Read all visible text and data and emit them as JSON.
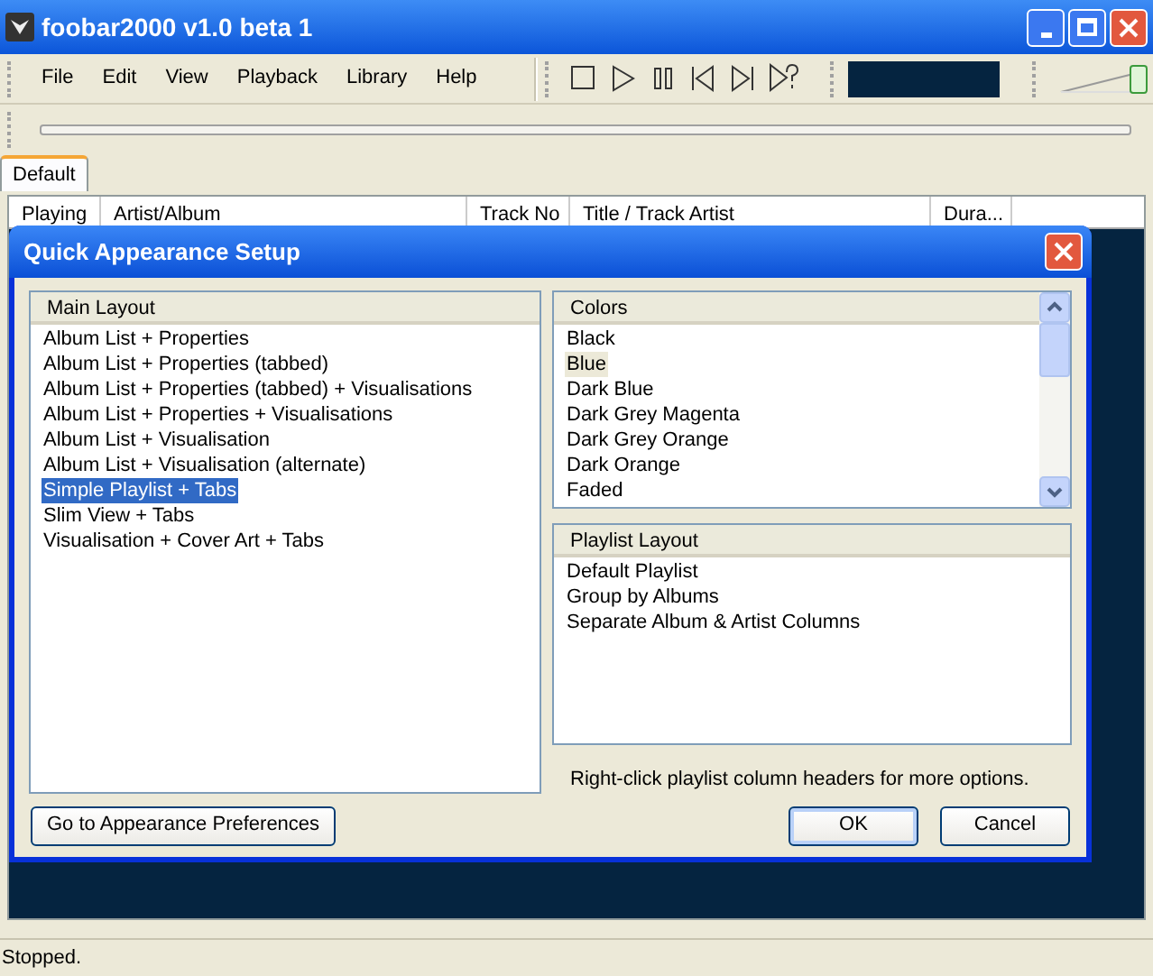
{
  "window": {
    "title": "foobar2000 v1.0 beta 1"
  },
  "menu": [
    "File",
    "Edit",
    "View",
    "Playback",
    "Library",
    "Help"
  ],
  "volume": {
    "level": 1
  },
  "tabs": [
    {
      "label": "Default",
      "selected": true
    }
  ],
  "playlist": {
    "columns": [
      "Playing",
      "Artist/Album",
      "Track No",
      "Title / Track Artist",
      "Dura..."
    ]
  },
  "dialog": {
    "title": "Quick Appearance Setup",
    "main_layout": {
      "header": "Main Layout",
      "items": [
        {
          "label": "Album List + Properties",
          "selected": false
        },
        {
          "label": "Album List + Properties (tabbed)",
          "selected": false
        },
        {
          "label": "Album List + Properties (tabbed) + Visualisations",
          "selected": false
        },
        {
          "label": "Album List + Properties + Visualisations",
          "selected": false
        },
        {
          "label": "Album List + Visualisation",
          "selected": false
        },
        {
          "label": "Album List + Visualisation (alternate)",
          "selected": false
        },
        {
          "label": "Simple Playlist + Tabs",
          "selected": true
        },
        {
          "label": "Slim View + Tabs",
          "selected": false
        },
        {
          "label": "Visualisation + Cover Art + Tabs",
          "selected": false
        }
      ]
    },
    "colors": {
      "header": "Colors",
      "items": [
        {
          "label": "Black",
          "selected": false
        },
        {
          "label": "Blue",
          "selected": true
        },
        {
          "label": "Dark Blue",
          "selected": false
        },
        {
          "label": "Dark Grey Magenta",
          "selected": false
        },
        {
          "label": "Dark Grey Orange",
          "selected": false
        },
        {
          "label": "Dark Orange",
          "selected": false
        },
        {
          "label": "Faded",
          "selected": false
        }
      ]
    },
    "playlist_layout": {
      "header": "Playlist Layout",
      "items": [
        {
          "label": "Default Playlist",
          "selected": false
        },
        {
          "label": "Group by Albums",
          "selected": false
        },
        {
          "label": "Separate Album & Artist Columns",
          "selected": false
        }
      ]
    },
    "hint": "Right-click playlist column headers for more options.",
    "preferences_button": "Go to Appearance Preferences",
    "ok_button": "OK",
    "cancel_button": "Cancel"
  },
  "status_bar": "Stopped."
}
